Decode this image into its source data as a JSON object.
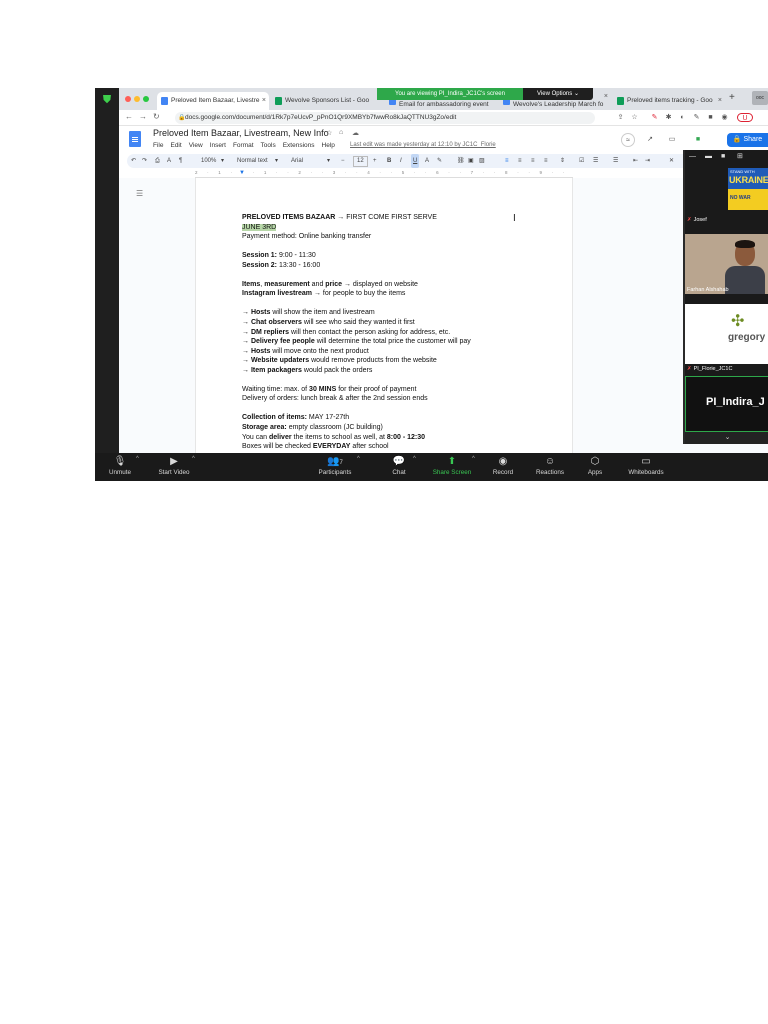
{
  "browser": {
    "tabs": [
      {
        "label": "Preloved Item Bazaar, Livestre",
        "favicon_color": "#4285f4",
        "active": true
      },
      {
        "label": "Wevolve Sponsors List - Goo",
        "favicon_color": "#0f9d58",
        "active": false
      },
      {
        "label": "Email for ambassadoring event",
        "favicon_color": "#4285f4",
        "active": false
      },
      {
        "label": "Wevolve's Leadership March fo",
        "favicon_color": "#4285f4",
        "active": false
      },
      {
        "label": "Preloved items tracking - Goo",
        "favicon_color": "#0f9d58",
        "active": false
      }
    ],
    "tab_close": "×",
    "new_tab": "+",
    "mini_label": "ooc",
    "url": "docs.google.com/document/d/1Rk7p7eUcvP_pPnO1Qr9XMBYb7fwwRo8kJaQTTNU3gZo/edit",
    "profile_initial": "U"
  },
  "screen_share": {
    "banner": "You are viewing PI_Indira_JC1C's screen",
    "view_options": "View Options ⌄"
  },
  "docs": {
    "title": "Preloved Item Bazaar, Livestream, New Info",
    "menu": [
      "File",
      "Edit",
      "View",
      "Insert",
      "Format",
      "Tools",
      "Extensions",
      "Help"
    ],
    "last_edit": "Last edit was made yesterday at 12:10 by JC1C_Florie",
    "share_label": "Share",
    "toolbar": {
      "zoom": "100%",
      "style": "Normal text",
      "font": "Arial",
      "size": "12",
      "bold": "B",
      "italic": "I",
      "underline": "U",
      "color": "A"
    },
    "ruler": "2 · 1 · · · 1 · · 2 · · 3 · · 4 · · 5 · · 6 · · 7 · · 8 · · 9 · · 10 · · 11 · · 12 · · 13 · · 14 · · 15 · · 16 · · 17 · · 18",
    "content": {
      "l1_bold": "PRELOVED ITEMS BAZAAR",
      "l1_rest": " → FIRST COME FIRST SERVE",
      "l2": "JUNE 3RD",
      "l3": "Payment method: Online banking transfer",
      "s1_bold": "Session 1:",
      "s1_rest": " 9:00 - 11:30",
      "s2_bold": "Session 2:",
      "s2_rest": " 13:30 - 16:00",
      "i1_a": "Items",
      "i1_b": ", ",
      "i1_c": "measurement",
      "i1_d": " and ",
      "i1_e": "price",
      "i1_f": " → displayed on website",
      "i2_a": "Instagram livestream",
      "i2_b": " → for people to buy the items",
      "r1_a": "→ ",
      "r1_b": "Hosts",
      "r1_c": " will show the item and livestream",
      "r2_a": "→ ",
      "r2_b": "Chat observers",
      "r2_c": " will see who said they wanted it first",
      "r3_a": "→ ",
      "r3_b": "DM repliers",
      "r3_c": " will then contact the person asking for address, etc.",
      "r4_a": "→ ",
      "r4_b": "Delivery fee people",
      "r4_c": " will determine the total price the customer will pay",
      "r5_a": "→ ",
      "r5_b": "Hosts",
      "r5_c": " will move onto the next product",
      "r6_a": "→ ",
      "r6_b": "Website updaters",
      "r6_c": " would remove products from the website",
      "r7_a": "→ ",
      "r7_b": "Item packagers",
      "r7_c": " would pack the orders",
      "w1_a": "Waiting time:  max. of ",
      "w1_b": "30 MINS",
      "w1_c": " for their proof of payment",
      "w2": "Delivery of orders: lunch break & after the 2nd session ends",
      "c1_a": "Collection of items:",
      "c1_b": " MAY 17-27th",
      "c2_a": "Storage area:",
      "c2_b": " empty classroom (JC building)",
      "c3_a": "You can ",
      "c3_b": "deliver",
      "c3_c": " the items to school as well, at ",
      "c3_d": "8:00 - 12:30",
      "c4_a": "Boxes will be checked ",
      "c4_b": "EVERYDAY",
      "c4_c": " after school"
    }
  },
  "gallery": {
    "participants": [
      {
        "name": "Josef"
      },
      {
        "name": "Farhan Alshahab"
      },
      {
        "name": "PI_Florie_JC1C"
      }
    ],
    "ukraine_small": "STAND WITH",
    "ukraine_big": "UKRAINE",
    "no_war": "NO WAR",
    "gregory_text": "gregory",
    "indira_label": "PI_Indira_J",
    "collapse": "⌄"
  },
  "controls": {
    "unmute": "Unmute",
    "start_video": "Start Video",
    "participants": "Participants",
    "participant_count": "7",
    "chat": "Chat",
    "share_screen": "Share Screen",
    "record": "Record",
    "reactions": "Reactions",
    "apps": "Apps",
    "whiteboards": "Whiteboards"
  },
  "colors": {
    "zoom_bg": "#1a1a1a",
    "share_green": "#2ea84a",
    "docs_blue": "#1a73e8",
    "highlight": "#b7d7a8"
  }
}
